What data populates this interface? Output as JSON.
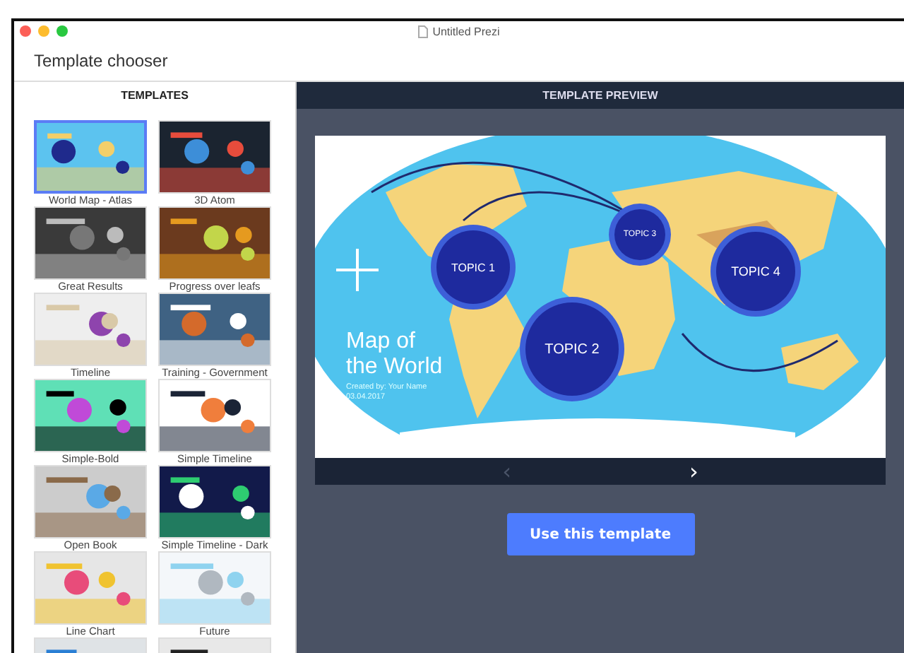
{
  "window": {
    "title": "Untitled Prezi"
  },
  "header": {
    "title": "Template chooser"
  },
  "templates_panel": {
    "heading": "TEMPLATES",
    "items": [
      {
        "label": "World Map - Atlas",
        "selected": true
      },
      {
        "label": "3D Atom",
        "selected": false
      },
      {
        "label": "Great Results",
        "selected": false
      },
      {
        "label": "Progress over leafs",
        "selected": false
      },
      {
        "label": "Timeline",
        "selected": false
      },
      {
        "label": "Training - Government",
        "selected": false
      },
      {
        "label": "Simple-Bold",
        "selected": false
      },
      {
        "label": "Simple Timeline",
        "selected": false
      },
      {
        "label": "Open Book",
        "selected": false
      },
      {
        "label": "Simple Timeline - Dark",
        "selected": false
      },
      {
        "label": "Line Chart",
        "selected": false
      },
      {
        "label": "Future",
        "selected": false
      },
      {
        "selected": false
      },
      {
        "selected": false
      }
    ]
  },
  "preview": {
    "heading": "TEMPLATE PREVIEW",
    "slide": {
      "title": "Map of the World",
      "author": "Created by: Your Name",
      "date": "03.04.2017",
      "topics": [
        {
          "label": "TOPIC 1"
        },
        {
          "label": "TOPIC 3"
        },
        {
          "label": "TOPIC 4"
        },
        {
          "label": "TOPIC 2"
        }
      ]
    },
    "nav": [
      {
        "label": "‹",
        "disabled": true
      },
      {
        "label": "›",
        "disabled": false
      }
    ],
    "button": "Use this template"
  }
}
